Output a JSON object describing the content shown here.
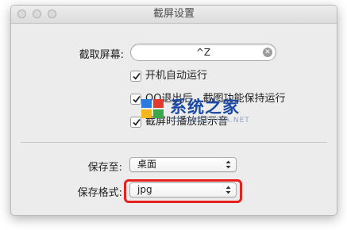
{
  "window": {
    "title": "截屏设置"
  },
  "shortcut": {
    "label": "截取屏幕:",
    "value": "^Z",
    "clear_glyph": "✕"
  },
  "options": [
    {
      "label": "开机自动运行",
      "checked": true
    },
    {
      "label": "QQ退出后，截图功能保持运行",
      "checked": true
    },
    {
      "label": "截屏时播放提示音",
      "checked": true
    }
  ],
  "save_location": {
    "label": "保存至:",
    "value": "桌面"
  },
  "save_format": {
    "label": "保存格式:",
    "value": "jpg"
  },
  "watermark": {
    "text": "系统之家",
    "sub": "XITONGZHIJIA.NET"
  },
  "colors": {
    "highlight": "#e5201d",
    "watermark": "#1a4aa6"
  }
}
